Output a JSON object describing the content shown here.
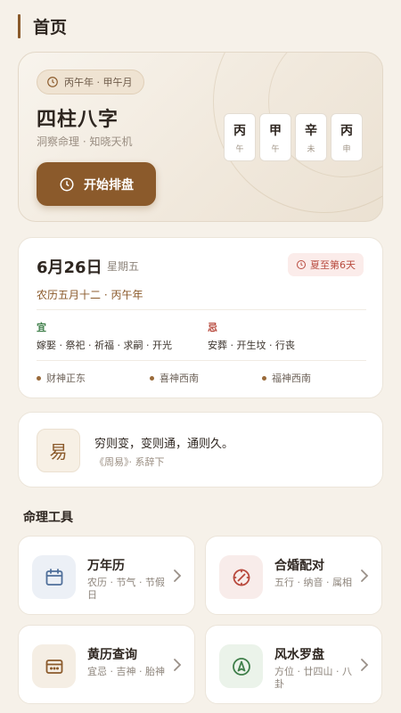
{
  "header": {
    "title": "首页"
  },
  "hero": {
    "year_month_pill": "丙午年 · 甲午月",
    "title": "四柱八字",
    "subtitle": "洞察命理 · 知晓天机",
    "start_button": "开始排盘",
    "pillars": [
      {
        "stem": "丙",
        "branch": "午"
      },
      {
        "stem": "甲",
        "branch": "午"
      },
      {
        "stem": "辛",
        "branch": "未"
      },
      {
        "stem": "丙",
        "branch": "申"
      }
    ]
  },
  "today": {
    "date": "6月26日",
    "weekday": "星期五",
    "solar_term_badge": "夏至第6天",
    "lunar": "农历五月十二 · 丙午年",
    "yi_label": "宜",
    "yi_items": "嫁娶 · 祭祀 · 祈福 · 求嗣 · 开光",
    "ji_label": "忌",
    "ji_items": "安葬 · 开生坟 · 行丧",
    "gods": [
      "财神正东",
      "喜神西南",
      "福神西南"
    ]
  },
  "quote": {
    "seal": "易",
    "text": "穷则变，变则通，通则久。",
    "source": "《周易》· 系辞下"
  },
  "tools_section": {
    "title": "命理工具",
    "tools": [
      {
        "name": "万年历",
        "desc": "农历 · 节气 · 节假日",
        "icon": "calendar-icon"
      },
      {
        "name": "合婚配对",
        "desc": "五行 · 纳音 · 属相",
        "icon": "compass-dial-icon"
      },
      {
        "name": "黄历查询",
        "desc": "宜忌 · 吉神 · 胎神",
        "icon": "almanac-icon"
      },
      {
        "name": "风水罗盘",
        "desc": "方位 · 廿四山 · 八卦",
        "icon": "navigation-compass-icon"
      }
    ]
  },
  "colors": {
    "background": "#f6f1e9",
    "accent": "#8b5a2b",
    "yi_green": "#3f7f4a",
    "ji_red": "#b84a3e"
  }
}
